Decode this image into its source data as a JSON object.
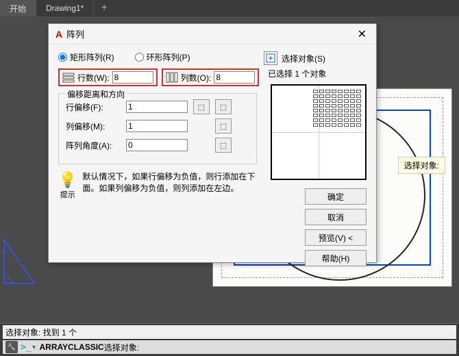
{
  "tabs": {
    "start": "开始",
    "drawing": "Drawing1*",
    "plus": "+"
  },
  "dialog": {
    "title": "阵列",
    "radio_rect": "矩形阵列(R)",
    "radio_polar": "环形阵列(P)",
    "select_objects": "选择对象(S)",
    "selected_count": "已选择 1 个对象",
    "rows_label": "行数(W):",
    "rows_value": "8",
    "cols_label": "列数(O):",
    "cols_value": "8",
    "offset_legend": "偏移距离和方向",
    "row_offset_label": "行偏移(F):",
    "row_offset_value": "1",
    "col_offset_label": "列偏移(M):",
    "col_offset_value": "1",
    "angle_label": "阵列角度(A):",
    "angle_value": "0",
    "hint_label": "提示",
    "hint_text": "默认情况下，如果行偏移为负值，则行添加在下面。如果列偏移为负值，则列添加在左边。",
    "btn_ok": "确定",
    "btn_cancel": "取消",
    "btn_preview": "预览(V) <",
    "btn_help": "帮助(H)"
  },
  "tooltip": "选择对象:",
  "cmd": {
    "line1": "选择对象: 找到 1 个",
    "line2_cmd": "ARRAYCLASSIC",
    "line2_rest": " 选择对象:"
  }
}
